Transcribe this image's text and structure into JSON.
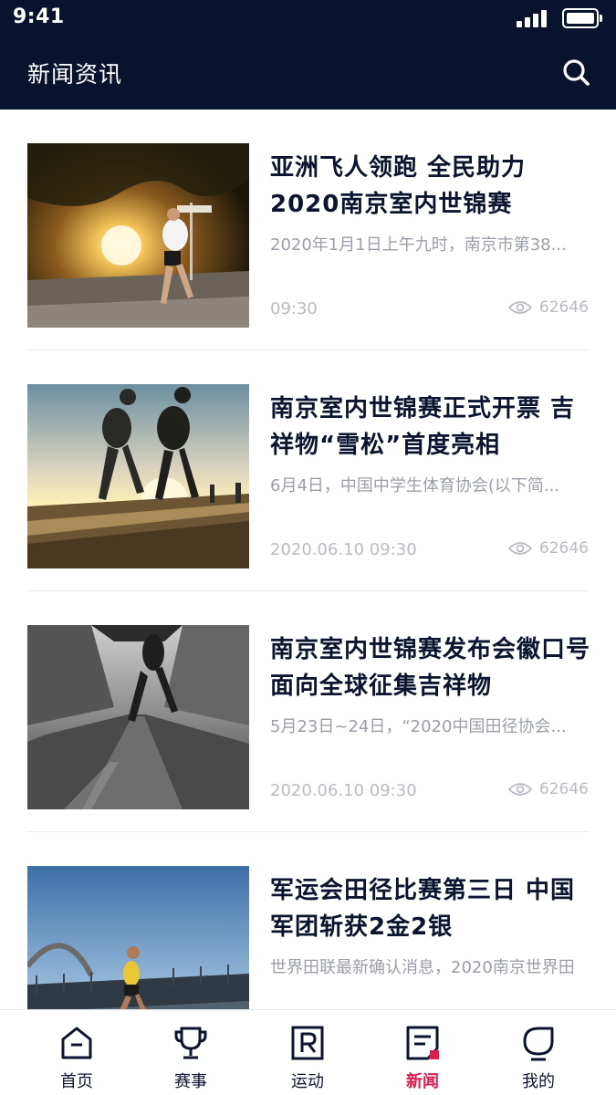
{
  "status_bar": {
    "time": "9:41"
  },
  "header": {
    "title": "新闻资讯"
  },
  "news": [
    {
      "title": "亚洲飞人领跑 全民助力2020南京室内世锦赛",
      "summary": "2020年1月1日上午九时，南京市第38...",
      "date": "09:30",
      "views": "62646"
    },
    {
      "title": "南京室内世锦赛正式开票 吉祥物“雪松”首度亮相",
      "summary": "6月4日，中国中学生体育协会(以下简...",
      "date": "2020.06.10  09:30",
      "views": "62646"
    },
    {
      "title": "南京室内世锦赛发布会徽口号面向全球征集吉祥物",
      "summary": "5月23日~24日，“2020中国田径协会...",
      "date": "2020.06.10  09:30",
      "views": "62646"
    },
    {
      "title": "军运会田径比赛第三日 中国军团斩获2金2银",
      "summary": "世界田联最新确认消息，2020南京世界田",
      "date": "",
      "views": ""
    }
  ],
  "tabs": [
    {
      "label": "首页",
      "icon": "home-icon"
    },
    {
      "label": "赛事",
      "icon": "trophy-icon"
    },
    {
      "label": "运动",
      "icon": "sport-icon"
    },
    {
      "label": "新闻",
      "icon": "news-icon",
      "active": true
    },
    {
      "label": "我的",
      "icon": "profile-icon"
    }
  ],
  "colors": {
    "header_bg": "#08142e",
    "accent": "#e01a4f",
    "text": "#0c1530",
    "muted": "#9a9ea8"
  }
}
